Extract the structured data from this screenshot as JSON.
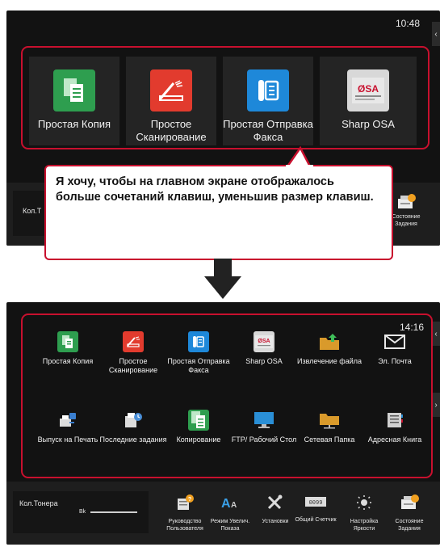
{
  "top_screen": {
    "time": "10:48",
    "keys": [
      {
        "label": "Простая Копия",
        "icon": "simple-copy-icon",
        "color": "#2e9e4f"
      },
      {
        "label": "Простое Сканирование",
        "icon": "simple-scan-icon",
        "color": "#e23b2e"
      },
      {
        "label": "Простая Отправка Факса",
        "icon": "simple-fax-icon",
        "color": "#1e88d9"
      },
      {
        "label": "Sharp OSA",
        "icon": "sharp-osa-icon",
        "color": "#d8d8d8"
      }
    ],
    "toner_label": "Кол.Т",
    "status_label": "Состояние Задания"
  },
  "callout": {
    "text": "Я хочу, чтобы на главном экране отображалось больше сочетаний клавиш, уменьшив размер клавиш."
  },
  "bottom_screen": {
    "time": "14:16",
    "keys": [
      {
        "label": "Простая Копия",
        "icon": "simple-copy-icon",
        "color": "#2e9e4f"
      },
      {
        "label": "Простое Сканирование",
        "icon": "simple-scan-icon",
        "color": "#e23b2e"
      },
      {
        "label": "Простая Отправка Факса",
        "icon": "simple-fax-icon",
        "color": "#1e88d9"
      },
      {
        "label": "Sharp OSA",
        "icon": "sharp-osa-icon",
        "color": "#d8d8d8"
      },
      {
        "label": "Извлечение файла",
        "icon": "file-retrieve-icon",
        "color": "#d99a2b"
      },
      {
        "label": "Эл. Почта",
        "icon": "email-icon",
        "color": "#e8e8e8"
      },
      {
        "label": "Выпуск на Печать",
        "icon": "print-release-icon",
        "color": "#3a7fd0"
      },
      {
        "label": "Последние задания",
        "icon": "recent-jobs-icon",
        "color": "#4a8fd8"
      },
      {
        "label": "Копирование",
        "icon": "copy-icon",
        "color": "#2e9e4f"
      },
      {
        "label": "FTP/ Рабочий Стол",
        "icon": "ftp-desktop-icon",
        "color": "#2a8fd6"
      },
      {
        "label": "Сетевая Папка",
        "icon": "network-folder-icon",
        "color": "#d99a2b"
      },
      {
        "label": "Адресная Книга",
        "icon": "address-book-icon",
        "color": "#d0d0d0"
      }
    ],
    "toner_label": "Кол.Тонера",
    "toner_color_label": "Bk",
    "bar_items": [
      {
        "label": "Руководство Пользователя",
        "icon": "user-guide-icon"
      },
      {
        "label": "Режим Увелич. Показа",
        "icon": "text-size-icon"
      },
      {
        "label": "Установки",
        "icon": "settings-tools-icon"
      },
      {
        "label": "Общий Счетчик",
        "icon": "total-counter-icon"
      },
      {
        "label": "Настройка Яркости",
        "icon": "brightness-icon"
      },
      {
        "label": "Состояние Задания",
        "icon": "job-status-icon"
      }
    ]
  }
}
